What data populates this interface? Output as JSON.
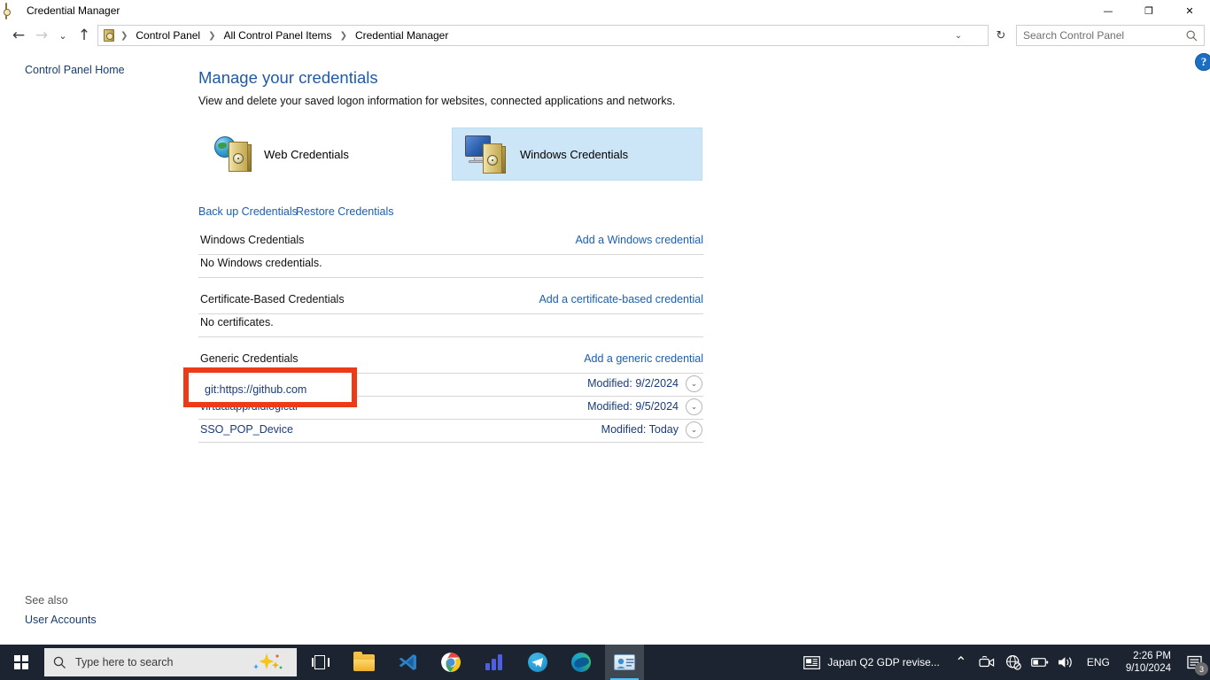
{
  "window": {
    "title": "Credential Manager",
    "icon": "vault-icon",
    "controls": {
      "minimize": "—",
      "maximize": "❐",
      "close": "✕"
    }
  },
  "addressbar": {
    "back_icon": "←",
    "forward_icon": "→",
    "recent_icon": "⌄",
    "up_icon": "↑",
    "breadcrumbs": [
      "Control Panel",
      "All Control Panel Items",
      "Credential Manager"
    ],
    "separator": "❯",
    "dropdown_icon": "⌄",
    "refresh_icon": "↻",
    "search_placeholder": "Search Control Panel"
  },
  "sidebar": {
    "home_link": "Control Panel Home",
    "see_also_label": "See also",
    "see_also_link": "User Accounts"
  },
  "main": {
    "help_label": "?",
    "title": "Manage your credentials",
    "subtitle": "View and delete your saved logon information for websites, connected applications and networks.",
    "tiles": [
      {
        "label": "Web Credentials",
        "selected": false
      },
      {
        "label": "Windows Credentials",
        "selected": true
      }
    ],
    "actions": [
      {
        "label": "Back up Credentials"
      },
      {
        "label": "Restore Credentials"
      }
    ],
    "sections": [
      {
        "title": "Windows Credentials",
        "action": "Add a Windows credential",
        "empty": "No Windows credentials.",
        "rows": []
      },
      {
        "title": "Certificate-Based Credentials",
        "action": "Add a certificate-based credential",
        "empty": "No certificates.",
        "rows": []
      },
      {
        "title": "Generic Credentials",
        "action": "Add a generic credential",
        "empty": "",
        "rows": [
          {
            "name": "git:https://github.com",
            "modified_label": "Modified:",
            "modified": "9/2/2024",
            "expand_icon": "⌄"
          },
          {
            "name": "virtualapp/didlogical",
            "modified_label": "Modified:",
            "modified": "9/5/2024",
            "expand_icon": "⌄"
          },
          {
            "name": "SSO_POP_Device",
            "modified_label": "Modified:",
            "modified": "Today",
            "expand_icon": "⌄"
          }
        ]
      }
    ]
  },
  "annotation": {
    "color": "#ed3b19",
    "highlighted_text": "git:https://github.com"
  },
  "taskbar": {
    "start_label": "Start",
    "search_placeholder": "Type here to search",
    "apps": [
      {
        "name": "task-view",
        "label": "Task View"
      },
      {
        "name": "file-explorer",
        "label": "File Explorer"
      },
      {
        "name": "vs-code",
        "label": "Visual Studio Code"
      },
      {
        "name": "chrome",
        "label": "Google Chrome"
      },
      {
        "name": "charts-app",
        "label": "Charts"
      },
      {
        "name": "telegram",
        "label": "Telegram"
      },
      {
        "name": "edge",
        "label": "Microsoft Edge"
      },
      {
        "name": "credential-manager",
        "label": "Credential Manager",
        "active": true
      }
    ],
    "tray": {
      "news": "Japan Q2 GDP revise...",
      "chevron": "⌃",
      "language": "ENG",
      "time": "2:26 PM",
      "date": "9/10/2024",
      "notification_count": "3"
    }
  }
}
